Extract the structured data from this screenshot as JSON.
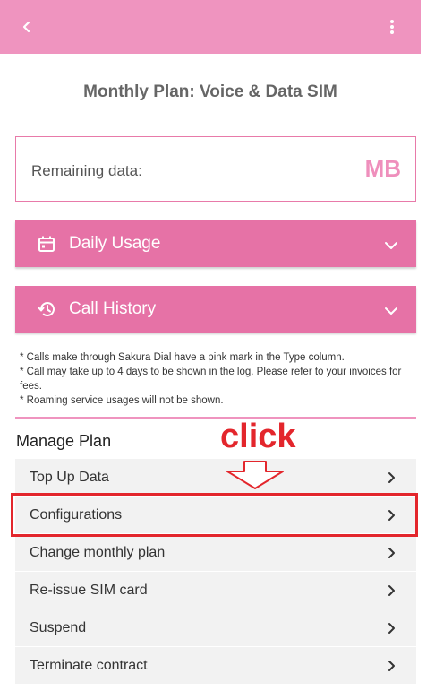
{
  "header": {
    "back_icon": "chevron-left-icon",
    "more_icon": "more-vertical-icon",
    "bar_color": "#ef94bf"
  },
  "page": {
    "title": "Monthly Plan: Voice & Data SIM"
  },
  "remaining": {
    "label": "Remaining data:",
    "unit": "MB",
    "unit_color": "#ef8fbc"
  },
  "accordions": [
    {
      "label": "Daily Usage",
      "icon": "calendar-icon"
    },
    {
      "label": "Call History",
      "icon": "history-icon"
    }
  ],
  "notes": [
    "* Calls make through Sakura Dial have a pink mark in the Type column.",
    "* Call may take up to 4 days to be shown in the log. Please refer to your invoices for fees.",
    "* Roaming service usages will not be shown."
  ],
  "manage": {
    "title": "Manage Plan",
    "items": [
      {
        "label": "Top Up Data"
      },
      {
        "label": "Configurations"
      },
      {
        "label": "Change monthly plan"
      },
      {
        "label": "Re-issue SIM card"
      },
      {
        "label": "Suspend"
      },
      {
        "label": "Terminate contract"
      }
    ]
  },
  "annotation": {
    "click_text": "click",
    "color": "#e3262c"
  },
  "colors": {
    "accent": "#e672a6",
    "divider": "#ef94bf"
  }
}
